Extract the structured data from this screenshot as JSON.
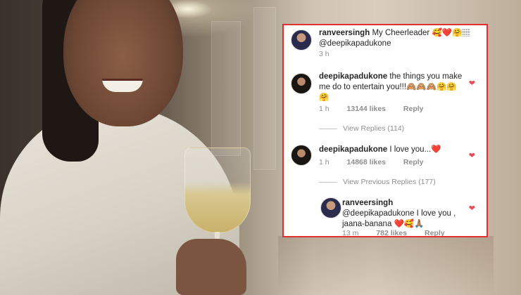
{
  "comments": [
    {
      "username": "ranveersingh",
      "text": "My Cheerleader 🥰❤️🤗🏽",
      "text2": "@deepikapadukone",
      "time": "3 h"
    },
    {
      "username": "deepikapadukone",
      "text": "the things you make me do to entertain you!!!🙈🙈🙈🤗🤗🤗",
      "time": "1 h",
      "likes": "13144 likes",
      "reply": "Reply",
      "view_replies": "View Replies (114)"
    },
    {
      "username": "deepikapadukone",
      "text": "I love you...❤️",
      "time": "1 h",
      "likes": "14868 likes",
      "reply": "Reply",
      "view_previous": "View Previous Replies (177)"
    },
    {
      "username": "ranveersingh",
      "text": "@deepikapadukone I love you , jaana-banana ❤️🥰🙏🏽",
      "time": "13 m",
      "likes": "782 likes",
      "reply": "Reply"
    }
  ],
  "colors": {
    "card_border": "#e0302f",
    "heart": "#ed4956",
    "muted": "#8e8e8e"
  },
  "icons": [
    "heart-icon",
    "avatar"
  ]
}
